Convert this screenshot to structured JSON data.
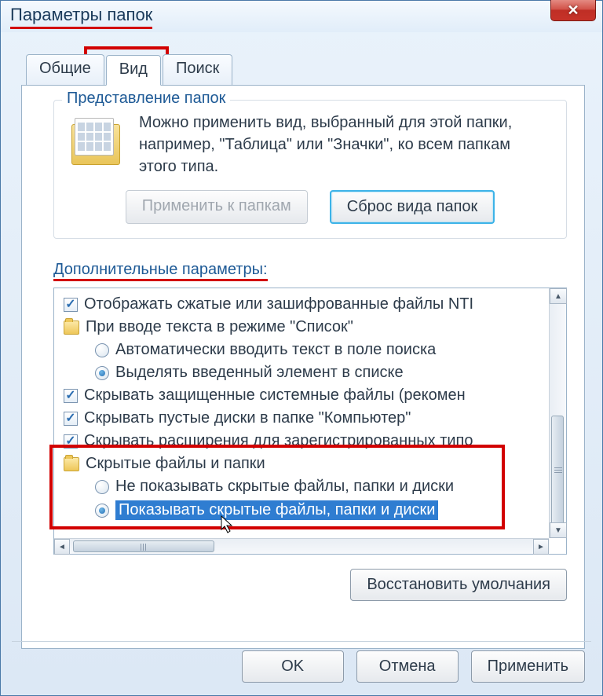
{
  "window": {
    "title": "Параметры папок"
  },
  "tabs": {
    "general": "Общие",
    "view": "Вид",
    "search": "Поиск"
  },
  "folderViews": {
    "title": "Представление папок",
    "description": "Можно применить вид, выбранный для этой папки, например, \"Таблица\" или \"Значки\", ко всем папкам этого типа.",
    "applyBtn": "Применить к папкам",
    "resetBtn": "Сброс вида папок"
  },
  "advanced": {
    "label": "Дополнительные параметры:",
    "items": {
      "compressed": "Отображать сжатые или зашифрованные файлы NTI",
      "listMode": "При вводе текста в режиме \"Список\"",
      "autoType": "Автоматически вводить текст в поле поиска",
      "selectTyped": "Выделять введенный элемент в списке",
      "hideProtected": "Скрывать защищенные системные файлы (рекомен",
      "hideEmpty": "Скрывать пустые диски в папке \"Компьютер\"",
      "hideExt": "Скрывать расширения для зарегистрированных типо",
      "hiddenGroup": "Скрытые файлы и папки",
      "dontShow": "Не показывать скрытые файлы, папки и диски",
      "show": "Показывать скрытые файлы, папки и диски"
    }
  },
  "buttons": {
    "restore": "Восстановить умолчания",
    "ok": "OK",
    "cancel": "Отмена",
    "apply": "Применить"
  }
}
